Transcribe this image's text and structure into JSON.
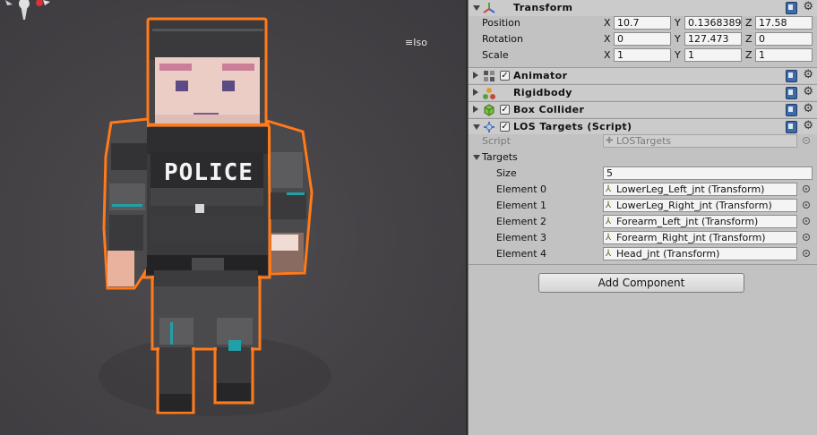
{
  "scene": {
    "view_mode_label": "Iso",
    "character_vest_text": "POLICE"
  },
  "inspector": {
    "transform": {
      "title": "Transform",
      "expanded": true,
      "position": {
        "label": "Position",
        "x": "10.7",
        "y": "0.1368389",
        "z": "17.58"
      },
      "rotation": {
        "label": "Rotation",
        "x": "0",
        "y": "127.473",
        "z": "0"
      },
      "scale": {
        "label": "Scale",
        "x": "1",
        "y": "1",
        "z": "1"
      },
      "axis_labels": {
        "x": "X",
        "y": "Y",
        "z": "Z"
      }
    },
    "components": [
      {
        "title": "Animator",
        "enabled": true,
        "has_checkbox": true,
        "icon": "animator-icon"
      },
      {
        "title": "Rigidbody",
        "has_checkbox": false,
        "icon": "rigidbody-icon"
      },
      {
        "title": "Box Collider",
        "enabled": true,
        "has_checkbox": true,
        "icon": "box-collider-icon"
      }
    ],
    "los_targets": {
      "title": "LOS Targets (Script)",
      "enabled": true,
      "script_label": "Script",
      "script_value": "LOSTargets",
      "targets_label": "Targets",
      "size_label": "Size",
      "size_value": "5",
      "elements": [
        {
          "label": "Element 0",
          "value": "LowerLeg_Left_jnt (Transform)"
        },
        {
          "label": "Element 1",
          "value": "LowerLeg_Right_jnt (Transform)"
        },
        {
          "label": "Element 2",
          "value": "Forearm_Left_jnt (Transform)"
        },
        {
          "label": "Element 3",
          "value": "Forearm_Right_jnt (Transform)"
        },
        {
          "label": "Element 4",
          "value": "Head_jnt (Transform)"
        }
      ]
    },
    "add_component_label": "Add Component"
  },
  "colors": {
    "selection_outline": "#ff7a1a",
    "inspector_bg": "#c2c2c2",
    "scene_bg": "#454347",
    "help_icon": "#3d6aa8"
  }
}
